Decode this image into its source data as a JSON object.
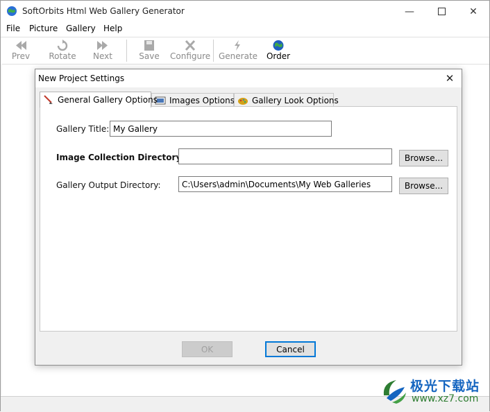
{
  "window": {
    "title": "SoftOrbits Html Web Gallery Generator"
  },
  "menu": [
    "File",
    "Picture",
    "Gallery",
    "Help"
  ],
  "toolbar": {
    "prev": "Prev",
    "rotate": "Rotate",
    "next": "Next",
    "save": "Save",
    "configure": "Configure",
    "generate": "Generate",
    "order": "Order"
  },
  "dialog": {
    "title": "New Project Settings",
    "tabs": [
      "General Gallery Options",
      "Images Options",
      "Gallery Look Options"
    ],
    "gallery_title_label": "Gallery Title:",
    "gallery_title_value": "My Gallery",
    "image_dir_label": "Image Collection Directory:",
    "image_dir_value": "",
    "output_dir_label": "Gallery Output Directory:",
    "output_dir_value": "C:\\Users\\admin\\Documents\\My Web Galleries",
    "browse_label": "Browse...",
    "ok_label": "OK",
    "cancel_label": "Cancel"
  },
  "watermark": {
    "brand": "极光下载站",
    "url": "www.xz7.com"
  },
  "colors": {
    "accent": "#0078d7",
    "dialog_bg": "#f0f0f0",
    "watermark_blue": "#1565c0",
    "watermark_green": "#2e7d32"
  }
}
